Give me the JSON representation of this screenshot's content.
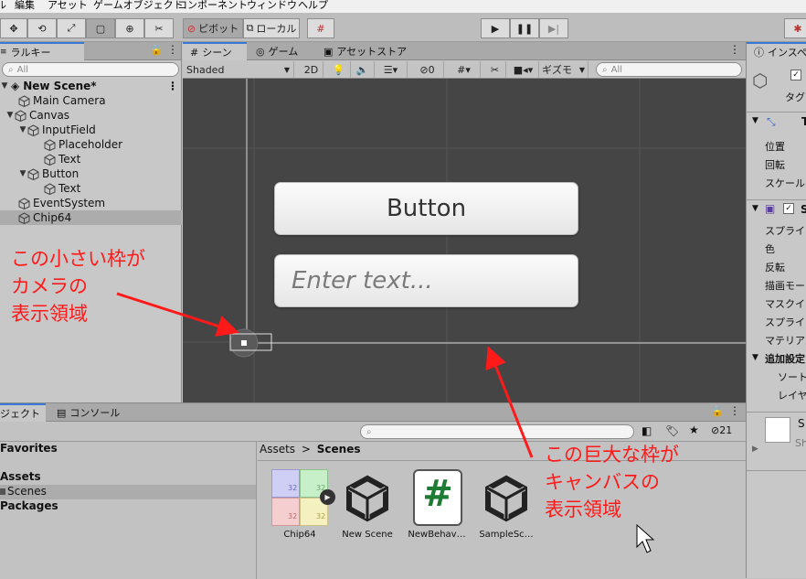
{
  "menu": [
    "ル",
    "編集",
    "アセット",
    "ゲームオブジェクト",
    "コンポーネント",
    "ウィンドウ",
    "ヘルプ"
  ],
  "toolbar": {
    "pivot_label": "ピボット",
    "local_label": "ローカル"
  },
  "hierarchy": {
    "tab_label": "ラルキー",
    "search_placeholder": "All",
    "scene_name": "New Scene*",
    "items": [
      {
        "label": "Main Camera"
      },
      {
        "label": "Canvas"
      },
      {
        "label": "InputField"
      },
      {
        "label": "Placeholder"
      },
      {
        "label": "Text"
      },
      {
        "label": "Button"
      },
      {
        "label": "Text"
      },
      {
        "label": "EventSystem"
      },
      {
        "label": "Chip64"
      }
    ]
  },
  "scene": {
    "tabs": [
      "シーン",
      "ゲーム",
      "アセットストア"
    ],
    "shading_mode": "Shaded",
    "mode_2d": "2D",
    "hidden_count": "0",
    "gizmos_label": "ギズモ",
    "search_placeholder": "All",
    "button_text": "Button",
    "input_placeholder": "Enter text..."
  },
  "project": {
    "tabs": [
      "ジェクト",
      "コンソール"
    ],
    "hidden_count": "21",
    "sidebar": {
      "favorites": "Favorites",
      "assets": "Assets",
      "scenes": "Scenes",
      "packages": "Packages"
    },
    "breadcrumb": {
      "root": "Assets",
      "sep": ">",
      "current": "Scenes"
    },
    "assets": [
      {
        "label": "Chip64",
        "icon": "sprite-sheet-icon",
        "cell_text": "32"
      },
      {
        "label": "New Scene",
        "icon": "unity-scene-icon"
      },
      {
        "label": "NewBehav…",
        "icon": "csharp-script-icon",
        "glyph": "#"
      },
      {
        "label": "SampleSc…",
        "icon": "unity-scene-icon"
      }
    ]
  },
  "inspector": {
    "tab_label": "インスペク",
    "tag_label": "タグ",
    "transform_initial": "T",
    "transform_rows": [
      "位置",
      "回転",
      "スケール"
    ],
    "sprite_initial": "S",
    "sprite_rows": [
      "スプライト",
      "色",
      "反転",
      "描画モード",
      "マスクイン",
      "スプライトソ",
      "マテリアル"
    ],
    "additional_label": "追加設定",
    "additional_rows": [
      "ソートレ",
      "レイヤー"
    ],
    "preview_text": "S",
    "preview_sub": "Sh"
  },
  "annotations": {
    "camera_note": "この小さい枠が\nカメラの\n表示領域",
    "canvas_note": "この巨大な枠が\nキャンバスの\n表示領域",
    "color": "#ff1a1a"
  }
}
